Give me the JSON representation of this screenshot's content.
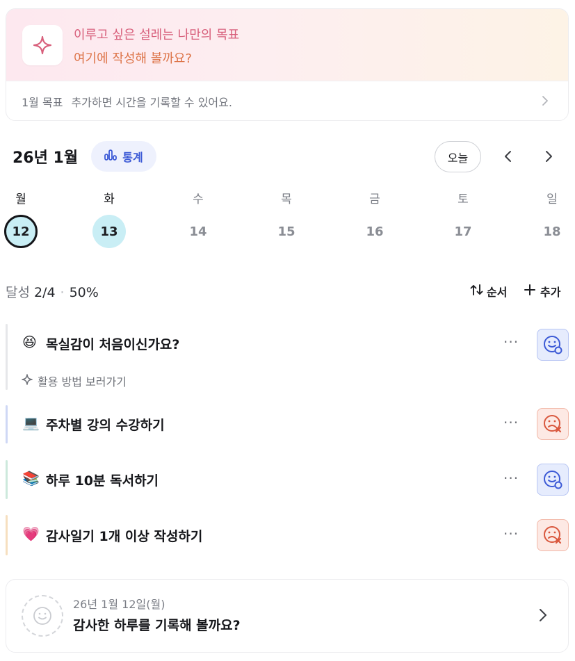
{
  "goal_card": {
    "headline_line1": "이루고 싶은 설레는 나만의 목표",
    "headline_line2": "여기에 작성해 볼까요?",
    "month_goal_label": "1월 목표",
    "month_goal_hint": "추가하면 시간을 기록할 수 있어요.",
    "icon": "sparkle-icon",
    "colors": {
      "line1": "#d8607c",
      "line2": "#dd7448"
    }
  },
  "calendar": {
    "month_title": "26년 1월",
    "stats_label": "통계",
    "today_label": "오늘",
    "weekdays": [
      "월",
      "화",
      "수",
      "목",
      "금",
      "토",
      "일"
    ],
    "dates": [
      "12",
      "13",
      "14",
      "15",
      "16",
      "17",
      "18"
    ],
    "selected_index": 0,
    "today_index": 1
  },
  "progress": {
    "label": "달성",
    "ratio": "2/4",
    "percent": "50%",
    "sort_label": "순서",
    "add_label": "추가"
  },
  "tasks": [
    {
      "emoji": "😆",
      "title": "목실감이 처음이신가요?",
      "hint": "활용 방법 보러가기",
      "status": "good",
      "bar_color": "#e6e7ea"
    },
    {
      "emoji": "💻",
      "title": "주차별 강의 수강하기",
      "status": "bad",
      "bar_color": "#cfd8f5"
    },
    {
      "emoji": "📚",
      "title": "하루 10분 독서하기",
      "status": "good",
      "bar_color": "#cde9dc"
    },
    {
      "emoji": "💗",
      "title": "감사일기 1개 이상 작성하기",
      "status": "bad",
      "bar_color": "#f6dfbf"
    }
  ],
  "journal": {
    "date": "26년 1월 12일(월)",
    "prompt": "감사한 하루를 기록해 볼까요?"
  },
  "theme": {
    "accent_blue": "#3c5ad6",
    "date_highlight": "#c9eef5",
    "status_good_bg": "#e6ecfd",
    "status_bad_bg": "#fde9e4"
  }
}
